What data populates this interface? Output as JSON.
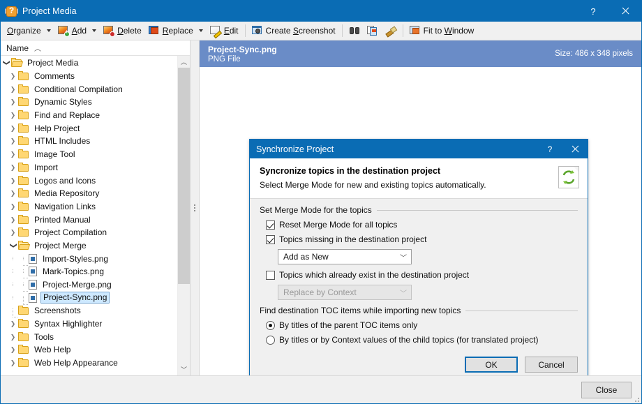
{
  "window": {
    "title": "Project Media",
    "app_icon": "help-media-icon",
    "help_label": "?",
    "close_label": "✕",
    "accent_color": "#0a6cb4"
  },
  "toolbar": {
    "items": [
      {
        "id": "organize",
        "label": "Organize",
        "accel": "O",
        "icon": "none",
        "dropdown": true
      },
      {
        "id": "add",
        "label": "Add",
        "accel": "A",
        "icon": "add-image-icon",
        "dropdown": true
      },
      {
        "id": "delete",
        "label": "Delete",
        "accel": "D",
        "icon": "delete-image-icon",
        "dropdown": false
      },
      {
        "id": "replace",
        "label": "Replace",
        "accel": "R",
        "icon": "replace-image-icon",
        "dropdown": true
      },
      {
        "id": "edit",
        "label": "Edit",
        "accel": "E",
        "icon": "edit-image-icon",
        "dropdown": false
      },
      {
        "id": "create-screenshot",
        "label": "Create Screenshot",
        "accel": "S",
        "icon": "screenshot-icon",
        "dropdown": false
      },
      {
        "id": "find",
        "label": "",
        "accel": "",
        "icon": "binoculars-icon",
        "dropdown": false
      },
      {
        "id": "copy",
        "label": "",
        "accel": "",
        "icon": "copy-image-icon",
        "dropdown": false
      },
      {
        "id": "clean",
        "label": "",
        "accel": "",
        "icon": "brush-icon",
        "dropdown": false
      },
      {
        "id": "fit-to-window",
        "label": "Fit to Window",
        "accel": "W",
        "icon": "fit-window-icon",
        "dropdown": false
      }
    ]
  },
  "tree": {
    "column_header": "Name",
    "sort_indicator": "︿",
    "rows": [
      {
        "label": "Project Media",
        "depth": 0,
        "type": "folder",
        "state": "open",
        "selected": false
      },
      {
        "label": "Comments",
        "depth": 1,
        "type": "folder",
        "state": "collapsed",
        "selected": false
      },
      {
        "label": "Conditional Compilation",
        "depth": 1,
        "type": "folder",
        "state": "collapsed",
        "selected": false
      },
      {
        "label": "Dynamic Styles",
        "depth": 1,
        "type": "folder",
        "state": "collapsed",
        "selected": false
      },
      {
        "label": "Find and Replace",
        "depth": 1,
        "type": "folder",
        "state": "collapsed",
        "selected": false
      },
      {
        "label": "Help Project",
        "depth": 1,
        "type": "folder",
        "state": "collapsed",
        "selected": false
      },
      {
        "label": "HTML Includes",
        "depth": 1,
        "type": "folder",
        "state": "collapsed",
        "selected": false
      },
      {
        "label": "Image Tool",
        "depth": 1,
        "type": "folder",
        "state": "collapsed",
        "selected": false
      },
      {
        "label": "Import",
        "depth": 1,
        "type": "folder",
        "state": "collapsed",
        "selected": false
      },
      {
        "label": "Logos and Icons",
        "depth": 1,
        "type": "folder",
        "state": "collapsed",
        "selected": false
      },
      {
        "label": "Media Repository",
        "depth": 1,
        "type": "folder",
        "state": "collapsed",
        "selected": false
      },
      {
        "label": "Navigation Links",
        "depth": 1,
        "type": "folder",
        "state": "collapsed",
        "selected": false
      },
      {
        "label": "Printed Manual",
        "depth": 1,
        "type": "folder",
        "state": "collapsed",
        "selected": false
      },
      {
        "label": "Project Compilation",
        "depth": 1,
        "type": "folder",
        "state": "collapsed",
        "selected": false
      },
      {
        "label": "Project Merge",
        "depth": 1,
        "type": "folder",
        "state": "open",
        "selected": false
      },
      {
        "label": "Import-Styles.png",
        "depth": 2,
        "type": "file",
        "state": "leaf",
        "selected": false
      },
      {
        "label": "Mark-Topics.png",
        "depth": 2,
        "type": "file",
        "state": "leaf",
        "selected": false
      },
      {
        "label": "Project-Merge.png",
        "depth": 2,
        "type": "file",
        "state": "leaf",
        "selected": false
      },
      {
        "label": "Project-Sync.png",
        "depth": 2,
        "type": "file",
        "state": "leaf-last",
        "selected": true
      },
      {
        "label": "Screenshots",
        "depth": 1,
        "type": "folder",
        "state": "leaf",
        "selected": false
      },
      {
        "label": "Syntax Highlighter",
        "depth": 1,
        "type": "folder",
        "state": "collapsed",
        "selected": false
      },
      {
        "label": "Tools",
        "depth": 1,
        "type": "folder",
        "state": "collapsed",
        "selected": false
      },
      {
        "label": "Web Help",
        "depth": 1,
        "type": "folder",
        "state": "collapsed",
        "selected": false
      },
      {
        "label": "Web Help Appearance",
        "depth": 1,
        "type": "folder",
        "state": "collapsed",
        "selected": false
      }
    ],
    "scroll_up": "︿",
    "scroll_down": "﹀"
  },
  "file_header": {
    "name": "Project-Sync.png",
    "type": "PNG File",
    "size": "Size: 486 x 348 pixels",
    "background": "#6a8cc7"
  },
  "dialog": {
    "title": "Synchronize Project",
    "help_label": "?",
    "close_label": "✕",
    "header_title": "Syncronize topics in the destination project",
    "header_subtitle": "Select Merge Mode for new and existing topics automatically.",
    "header_icon": "sync-document-icon",
    "group1": {
      "legend": "Set Merge Mode for the topics",
      "options": [
        {
          "id": "reset-merge-mode",
          "label": "Reset Merge Mode for all topics",
          "checked": true
        },
        {
          "id": "topics-missing",
          "label": "Topics missing in the destination project",
          "checked": true
        }
      ],
      "combo1": {
        "value": "Add as New",
        "disabled": false
      },
      "option3": {
        "id": "topics-existing",
        "label": "Topics which already exist in the destination project",
        "checked": false
      },
      "combo2": {
        "value": "Replace by Context",
        "disabled": true
      }
    },
    "group2": {
      "legend": "Find destination TOC items while importing new topics",
      "radios": [
        {
          "id": "by-parent-titles",
          "label": "By titles of the parent TOC items only",
          "checked": true
        },
        {
          "id": "by-titles-or-context",
          "label": "By titles or by Context values of the child topics (for translated project)",
          "checked": false
        }
      ]
    },
    "ok_label": "OK",
    "cancel_label": "Cancel"
  },
  "statusbar": {
    "close_label": "Close"
  }
}
